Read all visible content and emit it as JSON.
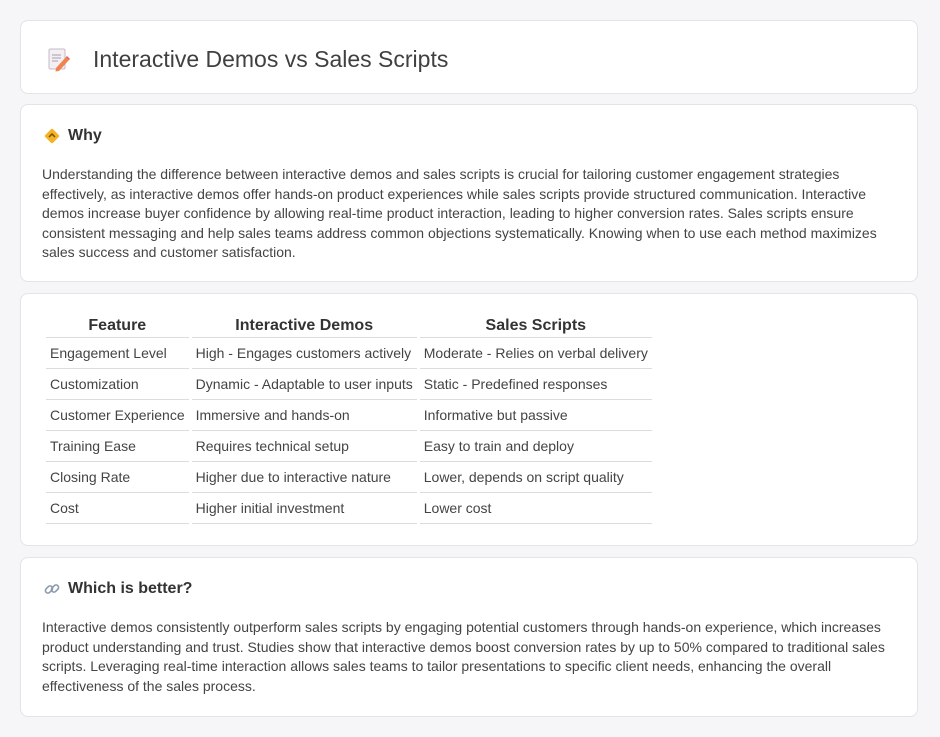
{
  "header": {
    "title": "Interactive Demos vs Sales Scripts",
    "icon": "document-pencil-icon"
  },
  "why": {
    "heading": "Why",
    "icon": "diamond-sign-icon",
    "body": "Understanding the difference between interactive demos and sales scripts is crucial for tailoring customer engagement strategies effectively, as interactive demos offer hands-on product experiences while sales scripts provide structured communication. Interactive demos increase buyer confidence by allowing real-time product interaction, leading to higher conversion rates. Sales scripts ensure consistent messaging and help sales teams address common objections systematically. Knowing when to use each method maximizes sales success and customer satisfaction."
  },
  "comparison": {
    "headers": [
      "Feature",
      "Interactive Demos",
      "Sales Scripts"
    ],
    "rows": [
      [
        "Engagement Level",
        "High - Engages customers actively",
        "Moderate - Relies on verbal delivery"
      ],
      [
        "Customization",
        "Dynamic - Adaptable to user inputs",
        "Static - Predefined responses"
      ],
      [
        "Customer Experience",
        "Immersive and hands-on",
        "Informative but passive"
      ],
      [
        "Training Ease",
        "Requires technical setup",
        "Easy to train and deploy"
      ],
      [
        "Closing Rate",
        "Higher due to interactive nature",
        "Lower, depends on script quality"
      ],
      [
        "Cost",
        "Higher initial investment",
        "Lower cost"
      ]
    ]
  },
  "better": {
    "heading": "Which is better?",
    "icon": "link-icon",
    "body": "Interactive demos consistently outperform sales scripts by engaging potential customers through hands-on experience, which increases product understanding and trust. Studies show that interactive demos boost conversion rates by up to 50% compared to traditional sales scripts. Leveraging real-time interaction allows sales teams to tailor presentations to specific client needs, enhancing the overall effectiveness of the sales process."
  }
}
